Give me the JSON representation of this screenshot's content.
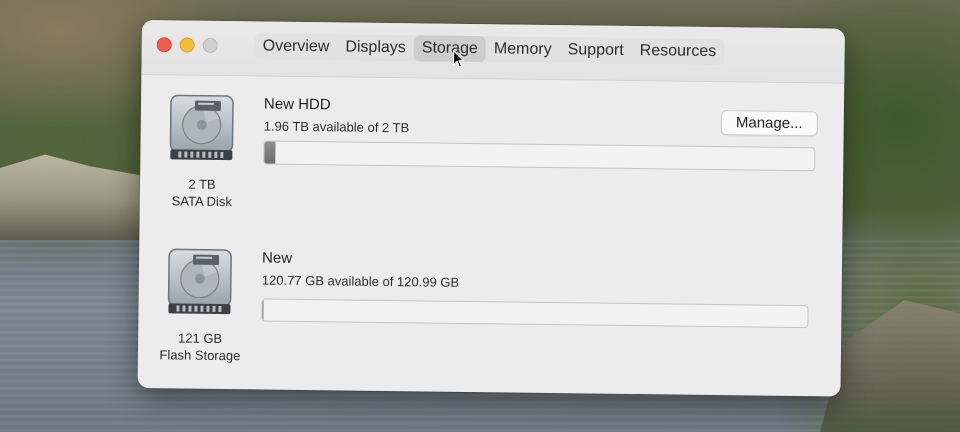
{
  "window": {
    "tabs": [
      {
        "label": "Overview"
      },
      {
        "label": "Displays"
      },
      {
        "label": "Storage"
      },
      {
        "label": "Memory"
      },
      {
        "label": "Support"
      },
      {
        "label": "Resources"
      }
    ],
    "active_tab": "Storage"
  },
  "disks": [
    {
      "name": "New HDD",
      "available": "1.96 TB available of 2 TB",
      "capacity_label": "2 TB",
      "type_label": "SATA Disk",
      "used_fraction": 0.02,
      "action_label": "Manage...",
      "icon": "hard-drive-icon"
    },
    {
      "name": "New",
      "available": "120.77 GB available of 120.99 GB",
      "capacity_label": "121 GB",
      "type_label": "Flash Storage",
      "used_fraction": 0.002,
      "icon": "hard-drive-icon"
    }
  ],
  "colors": {
    "close": "#ed5f55",
    "minimize": "#f3bb3b",
    "zoom_inactive": "#cfcfcf",
    "bar_fill": "#7a7a7a"
  }
}
